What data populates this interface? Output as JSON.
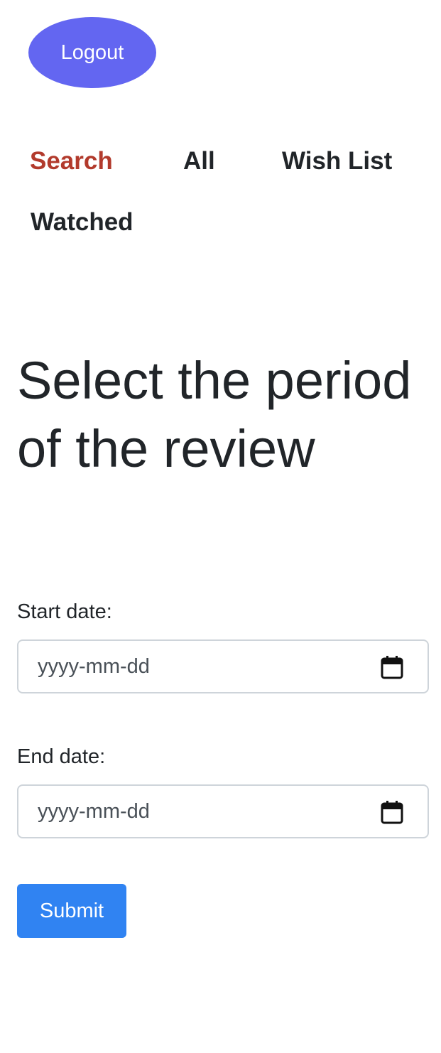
{
  "header": {
    "logout_label": "Logout"
  },
  "nav": {
    "items": [
      {
        "label": "Search",
        "active": true
      },
      {
        "label": "All",
        "active": false
      },
      {
        "label": "Wish List",
        "active": false
      },
      {
        "label": "Watched",
        "active": false
      }
    ]
  },
  "main": {
    "title": "Select the period of the review",
    "start_date": {
      "label": "Start date:",
      "placeholder": "yyyy-mm-dd"
    },
    "end_date": {
      "label": "End date:",
      "placeholder": "yyyy-mm-dd"
    },
    "submit_label": "Submit"
  },
  "colors": {
    "logout_bg": "#6366f1",
    "active_nav": "#b23a2c",
    "submit_bg": "#3083f2",
    "text": "#212529"
  },
  "icons": {
    "date_picker": "calendar-icon"
  }
}
